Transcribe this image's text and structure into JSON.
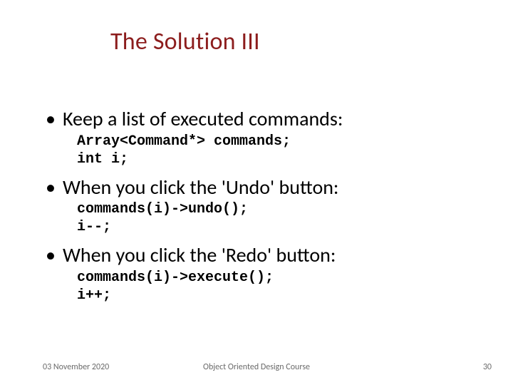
{
  "title": "The Solution III",
  "bullets": [
    {
      "text": "Keep a list of executed commands:",
      "code": "Array<Command*> commands;\nint i;"
    },
    {
      "text": "When you click the 'Undo' button:",
      "code": "commands(i)->undo();\ni--;"
    },
    {
      "text": "When you click the 'Redo' button:",
      "code": "commands(i)->execute();\ni++;"
    }
  ],
  "footer": {
    "date": "03 November 2020",
    "course": "Object Oriented Design Course",
    "page": "30"
  }
}
